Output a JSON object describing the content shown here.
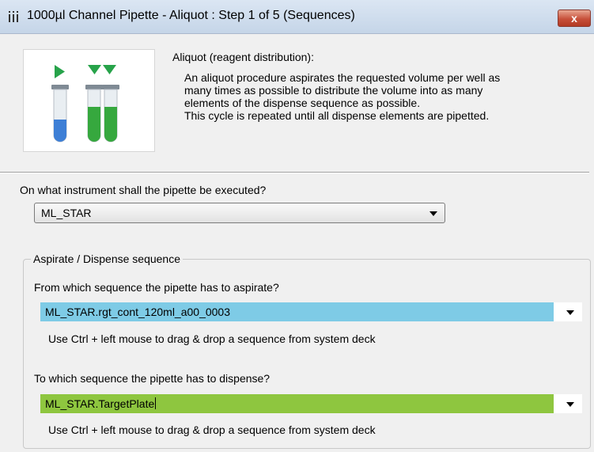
{
  "window": {
    "title": "1000µl Channel Pipette - Aliquot : Step 1 of 5 (Sequences)",
    "close_label": "x"
  },
  "description": {
    "title": "Aliquot (reagent distribution):",
    "lines": [
      "An aliquot procedure aspirates the requested volume per well as",
      "many times as possible to distribute the volume into as many",
      "elements of the dispense sequence as possible.",
      "This cycle is repeated until all dispense elements are pipetted."
    ]
  },
  "instrument": {
    "question": "On what instrument shall the pipette be executed?",
    "selected": "ML_STAR"
  },
  "sequence_group": {
    "legend": "Aspirate / Dispense sequence",
    "aspirate": {
      "question": "From which sequence the pipette has to aspirate?",
      "value": "ML_STAR.rgt_cont_120ml_a00_0003",
      "hint": "Use Ctrl + left mouse to drag & drop a sequence from system deck",
      "color": "#7ecbe6"
    },
    "dispense": {
      "question": "To which sequence the pipette has to dispense?",
      "value": "ML_STAR.TargetPlate",
      "hint": "Use Ctrl + left mouse to drag & drop a sequence from system deck",
      "color": "#8ec63f"
    }
  },
  "icons": {
    "app": "pipette-tips-icon",
    "illustration": "aliquot-tubes-illustration"
  }
}
